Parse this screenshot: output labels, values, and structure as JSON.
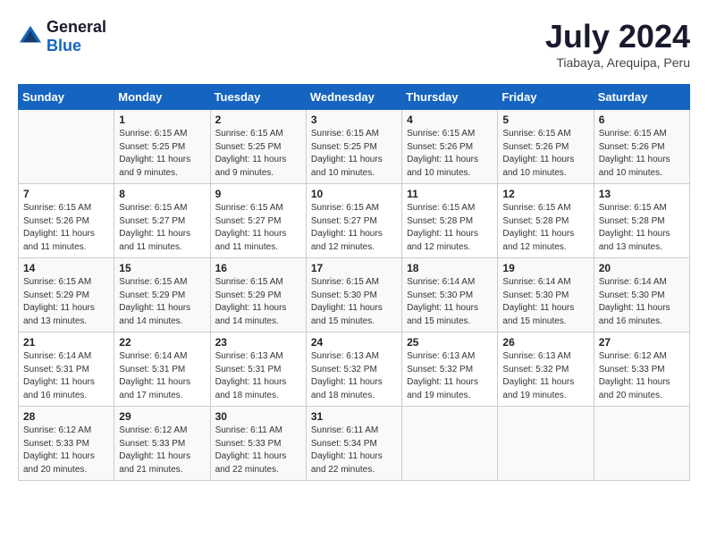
{
  "header": {
    "logo_general": "General",
    "logo_blue": "Blue",
    "month_year": "July 2024",
    "location": "Tiabaya, Arequipa, Peru"
  },
  "days_of_week": [
    "Sunday",
    "Monday",
    "Tuesday",
    "Wednesday",
    "Thursday",
    "Friday",
    "Saturday"
  ],
  "weeks": [
    [
      {
        "day": "",
        "sunrise": "",
        "sunset": "",
        "daylight": ""
      },
      {
        "day": "1",
        "sunrise": "Sunrise: 6:15 AM",
        "sunset": "Sunset: 5:25 PM",
        "daylight": "Daylight: 11 hours and 9 minutes."
      },
      {
        "day": "2",
        "sunrise": "Sunrise: 6:15 AM",
        "sunset": "Sunset: 5:25 PM",
        "daylight": "Daylight: 11 hours and 9 minutes."
      },
      {
        "day": "3",
        "sunrise": "Sunrise: 6:15 AM",
        "sunset": "Sunset: 5:25 PM",
        "daylight": "Daylight: 11 hours and 10 minutes."
      },
      {
        "day": "4",
        "sunrise": "Sunrise: 6:15 AM",
        "sunset": "Sunset: 5:26 PM",
        "daylight": "Daylight: 11 hours and 10 minutes."
      },
      {
        "day": "5",
        "sunrise": "Sunrise: 6:15 AM",
        "sunset": "Sunset: 5:26 PM",
        "daylight": "Daylight: 11 hours and 10 minutes."
      },
      {
        "day": "6",
        "sunrise": "Sunrise: 6:15 AM",
        "sunset": "Sunset: 5:26 PM",
        "daylight": "Daylight: 11 hours and 10 minutes."
      }
    ],
    [
      {
        "day": "7",
        "sunrise": "Sunrise: 6:15 AM",
        "sunset": "Sunset: 5:26 PM",
        "daylight": "Daylight: 11 hours and 11 minutes."
      },
      {
        "day": "8",
        "sunrise": "Sunrise: 6:15 AM",
        "sunset": "Sunset: 5:27 PM",
        "daylight": "Daylight: 11 hours and 11 minutes."
      },
      {
        "day": "9",
        "sunrise": "Sunrise: 6:15 AM",
        "sunset": "Sunset: 5:27 PM",
        "daylight": "Daylight: 11 hours and 11 minutes."
      },
      {
        "day": "10",
        "sunrise": "Sunrise: 6:15 AM",
        "sunset": "Sunset: 5:27 PM",
        "daylight": "Daylight: 11 hours and 12 minutes."
      },
      {
        "day": "11",
        "sunrise": "Sunrise: 6:15 AM",
        "sunset": "Sunset: 5:28 PM",
        "daylight": "Daylight: 11 hours and 12 minutes."
      },
      {
        "day": "12",
        "sunrise": "Sunrise: 6:15 AM",
        "sunset": "Sunset: 5:28 PM",
        "daylight": "Daylight: 11 hours and 12 minutes."
      },
      {
        "day": "13",
        "sunrise": "Sunrise: 6:15 AM",
        "sunset": "Sunset: 5:28 PM",
        "daylight": "Daylight: 11 hours and 13 minutes."
      }
    ],
    [
      {
        "day": "14",
        "sunrise": "Sunrise: 6:15 AM",
        "sunset": "Sunset: 5:29 PM",
        "daylight": "Daylight: 11 hours and 13 minutes."
      },
      {
        "day": "15",
        "sunrise": "Sunrise: 6:15 AM",
        "sunset": "Sunset: 5:29 PM",
        "daylight": "Daylight: 11 hours and 14 minutes."
      },
      {
        "day": "16",
        "sunrise": "Sunrise: 6:15 AM",
        "sunset": "Sunset: 5:29 PM",
        "daylight": "Daylight: 11 hours and 14 minutes."
      },
      {
        "day": "17",
        "sunrise": "Sunrise: 6:15 AM",
        "sunset": "Sunset: 5:30 PM",
        "daylight": "Daylight: 11 hours and 15 minutes."
      },
      {
        "day": "18",
        "sunrise": "Sunrise: 6:14 AM",
        "sunset": "Sunset: 5:30 PM",
        "daylight": "Daylight: 11 hours and 15 minutes."
      },
      {
        "day": "19",
        "sunrise": "Sunrise: 6:14 AM",
        "sunset": "Sunset: 5:30 PM",
        "daylight": "Daylight: 11 hours and 15 minutes."
      },
      {
        "day": "20",
        "sunrise": "Sunrise: 6:14 AM",
        "sunset": "Sunset: 5:30 PM",
        "daylight": "Daylight: 11 hours and 16 minutes."
      }
    ],
    [
      {
        "day": "21",
        "sunrise": "Sunrise: 6:14 AM",
        "sunset": "Sunset: 5:31 PM",
        "daylight": "Daylight: 11 hours and 16 minutes."
      },
      {
        "day": "22",
        "sunrise": "Sunrise: 6:14 AM",
        "sunset": "Sunset: 5:31 PM",
        "daylight": "Daylight: 11 hours and 17 minutes."
      },
      {
        "day": "23",
        "sunrise": "Sunrise: 6:13 AM",
        "sunset": "Sunset: 5:31 PM",
        "daylight": "Daylight: 11 hours and 18 minutes."
      },
      {
        "day": "24",
        "sunrise": "Sunrise: 6:13 AM",
        "sunset": "Sunset: 5:32 PM",
        "daylight": "Daylight: 11 hours and 18 minutes."
      },
      {
        "day": "25",
        "sunrise": "Sunrise: 6:13 AM",
        "sunset": "Sunset: 5:32 PM",
        "daylight": "Daylight: 11 hours and 19 minutes."
      },
      {
        "day": "26",
        "sunrise": "Sunrise: 6:13 AM",
        "sunset": "Sunset: 5:32 PM",
        "daylight": "Daylight: 11 hours and 19 minutes."
      },
      {
        "day": "27",
        "sunrise": "Sunrise: 6:12 AM",
        "sunset": "Sunset: 5:33 PM",
        "daylight": "Daylight: 11 hours and 20 minutes."
      }
    ],
    [
      {
        "day": "28",
        "sunrise": "Sunrise: 6:12 AM",
        "sunset": "Sunset: 5:33 PM",
        "daylight": "Daylight: 11 hours and 20 minutes."
      },
      {
        "day": "29",
        "sunrise": "Sunrise: 6:12 AM",
        "sunset": "Sunset: 5:33 PM",
        "daylight": "Daylight: 11 hours and 21 minutes."
      },
      {
        "day": "30",
        "sunrise": "Sunrise: 6:11 AM",
        "sunset": "Sunset: 5:33 PM",
        "daylight": "Daylight: 11 hours and 22 minutes."
      },
      {
        "day": "31",
        "sunrise": "Sunrise: 6:11 AM",
        "sunset": "Sunset: 5:34 PM",
        "daylight": "Daylight: 11 hours and 22 minutes."
      },
      {
        "day": "",
        "sunrise": "",
        "sunset": "",
        "daylight": ""
      },
      {
        "day": "",
        "sunrise": "",
        "sunset": "",
        "daylight": ""
      },
      {
        "day": "",
        "sunrise": "",
        "sunset": "",
        "daylight": ""
      }
    ]
  ]
}
